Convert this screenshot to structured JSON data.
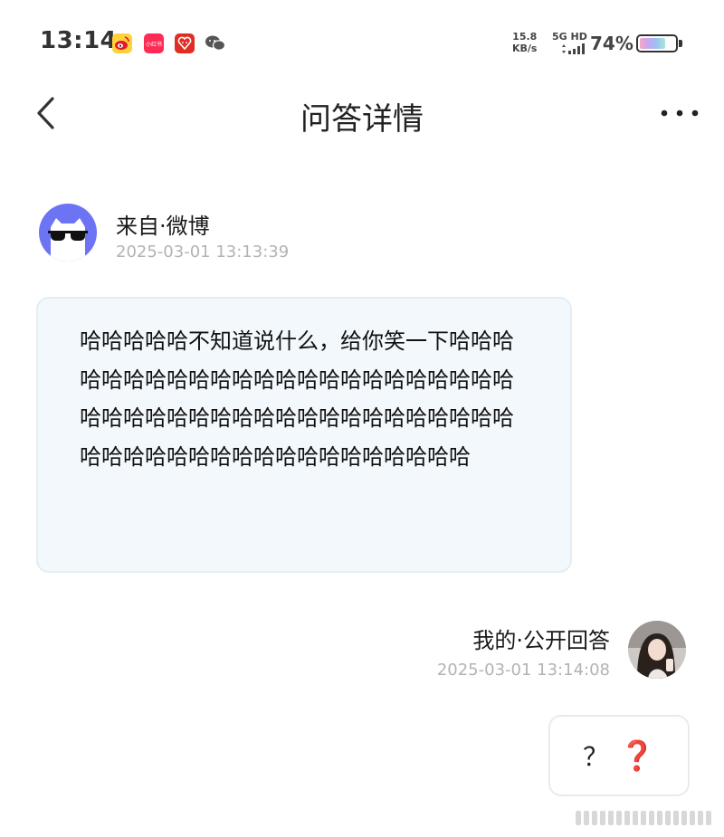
{
  "status_bar": {
    "time": "13:14",
    "app_icons": [
      "weibo-icon",
      "xiaohongshu-icon",
      "pinduoduo-icon",
      "wechat-icon"
    ],
    "xiaohongshu_label": "小红书",
    "net_speed_value": "15.8",
    "net_speed_unit": "KB/s",
    "network_type": "5G HD",
    "battery_percent": "74%",
    "battery_level": 0.74
  },
  "header": {
    "title": "问答详情",
    "back_icon": "chevron-left-icon",
    "more_icon": "more-dots-icon"
  },
  "question": {
    "source": "来自·微博",
    "timestamp": "2025-03-01 13:13:39",
    "text": "哈哈哈哈哈不知道说什么，给你笑一下哈哈哈哈哈哈哈哈哈哈哈哈哈哈哈哈哈哈哈哈哈哈哈哈哈哈哈哈哈哈哈哈哈哈哈哈哈哈哈哈哈哈哈哈哈哈哈哈哈哈哈哈哈哈哈哈哈哈哈哈哈"
  },
  "answer": {
    "source": "我的·公开回答",
    "timestamp": "2025-03-01 13:14:08",
    "text": "？",
    "emoji": "❓"
  },
  "colors": {
    "accent_avatar": "#6c74f3",
    "bubble_bg": "#f3f8fd",
    "timestamp": "#b3b3b3",
    "red_mark": "#d9262c"
  }
}
